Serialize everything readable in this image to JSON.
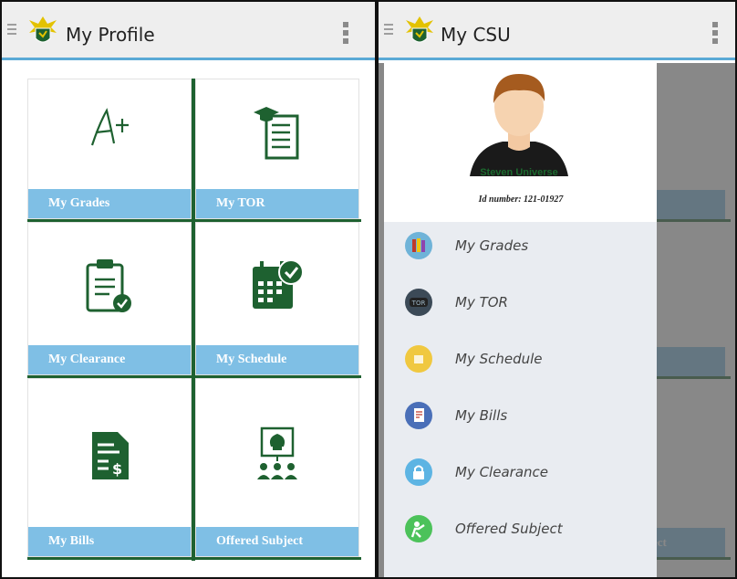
{
  "left": {
    "title": "My Profile",
    "tiles": [
      {
        "label": "My Grades",
        "icon": "a-plus-icon"
      },
      {
        "label": "My TOR",
        "icon": "transcript-icon"
      },
      {
        "label": "My Clearance",
        "icon": "clipboard-check-icon"
      },
      {
        "label": "My Schedule",
        "icon": "calendar-check-icon"
      },
      {
        "label": "My Bills",
        "icon": "bill-icon"
      },
      {
        "label": "Offered Subject",
        "icon": "presentation-idea-icon"
      }
    ]
  },
  "right": {
    "title": "My CSU",
    "profile": {
      "name": "Steven Universe",
      "id_label": "Id number: 121-01927"
    },
    "menu": [
      {
        "label": "My Grades",
        "icon": "books-icon",
        "color": "#6fb3d8"
      },
      {
        "label": "My TOR",
        "icon": "tor-badge-icon",
        "color": "#3c4a57",
        "badge": "TOR"
      },
      {
        "label": "My Schedule",
        "icon": "schedule-icon",
        "color": "#f0c840"
      },
      {
        "label": "My Bills",
        "icon": "receipt-icon",
        "color": "#4a6fb8"
      },
      {
        "label": "My Clearance",
        "icon": "lock-icon",
        "color": "#5db4e3"
      },
      {
        "label": "Offered Subject",
        "icon": "teacher-icon",
        "color": "#4cc25a"
      }
    ],
    "ghost_text": "ect"
  },
  "colors": {
    "accent_green": "#1e6130",
    "tile_label_bg": "#7fbfe5",
    "appbar_line": "#5aa9d6"
  }
}
